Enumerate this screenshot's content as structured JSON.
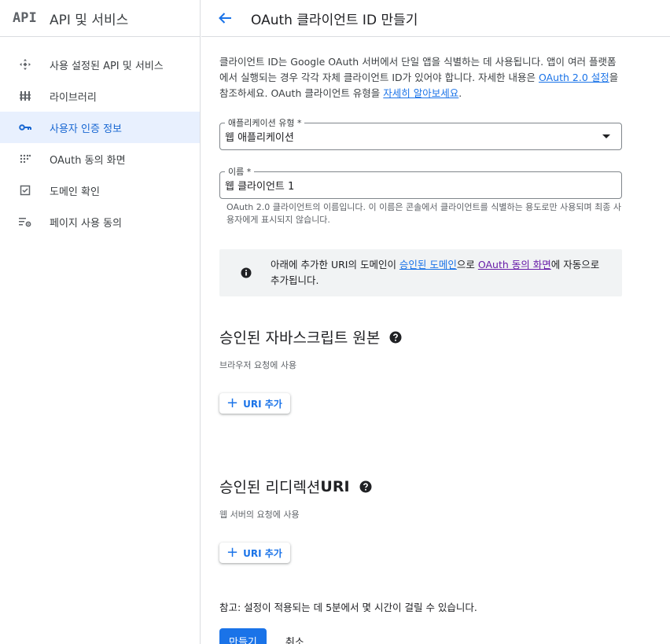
{
  "sidebar": {
    "logo": "API",
    "title": "API 및 서비스",
    "items": [
      {
        "label": "사용 설정된 API 및 서비스",
        "icon": "diamond-icon",
        "active": false
      },
      {
        "label": "라이브러리",
        "icon": "library-icon",
        "active": false
      },
      {
        "label": "사용자 인증 정보",
        "icon": "key-icon",
        "active": true
      },
      {
        "label": "OAuth 동의 화면",
        "icon": "dots-icon",
        "active": false
      },
      {
        "label": "도메인 확인",
        "icon": "checkbox-icon",
        "active": false
      },
      {
        "label": "페이지 사용 동의",
        "icon": "settings-list-icon",
        "active": false
      }
    ]
  },
  "header": {
    "title": "OAuth 클라이언트 ID 만들기"
  },
  "intro": {
    "text1": "클라이언트 ID는 Google OAuth 서버에서 단일 앱을 식별하는 데 사용됩니다. 앱이 여러 플랫폼에서 실행되는 경우 각각 자체 클라이언트 ID가 있어야 합니다. 자세한 내용은 ",
    "link1": "OAuth 2.0 설정",
    "text2": "을 참조하세요. OAuth 클라이언트 유형을 ",
    "link2": "자세히 알아보세요",
    "text3": "."
  },
  "app_type": {
    "label": "애플리케이션 유형 *",
    "value": "웹 애플리케이션"
  },
  "name_field": {
    "label": "이름 *",
    "value": "웹 클라이언트 1",
    "hint": "OAuth 2.0 클라이언트의 이름입니다. 이 이름은 콘솔에서 클라이언트를 식별하는 용도로만 사용되며 최종 사용자에게 표시되지 않습니다."
  },
  "info": {
    "text1": "아래에 추가한 URI의 도메인이 ",
    "link1": "승인된 도메인",
    "text2": "으로 ",
    "link2": "OAuth 동의 화면",
    "text3": "에 자동으로 추가됩니다."
  },
  "js_origins": {
    "title": "승인된 자바스크립트 원본",
    "subtitle": "브라우저 요청에 사용",
    "button": "URI 추가"
  },
  "redirect_uris": {
    "title_prefix": "승인된 리디렉션 ",
    "title_bold": "URI",
    "subtitle": "웹 서버의 요청에 사용",
    "button": "URI 추가"
  },
  "note": "참고: 설정이 적용되는 데 5분에서 몇 시간이 걸릴 수 있습니다.",
  "actions": {
    "create": "만들기",
    "cancel": "취소"
  },
  "colors": {
    "accent": "#1a73e8",
    "active_bg": "#e8f0fe",
    "visited_link": "#681da8"
  }
}
